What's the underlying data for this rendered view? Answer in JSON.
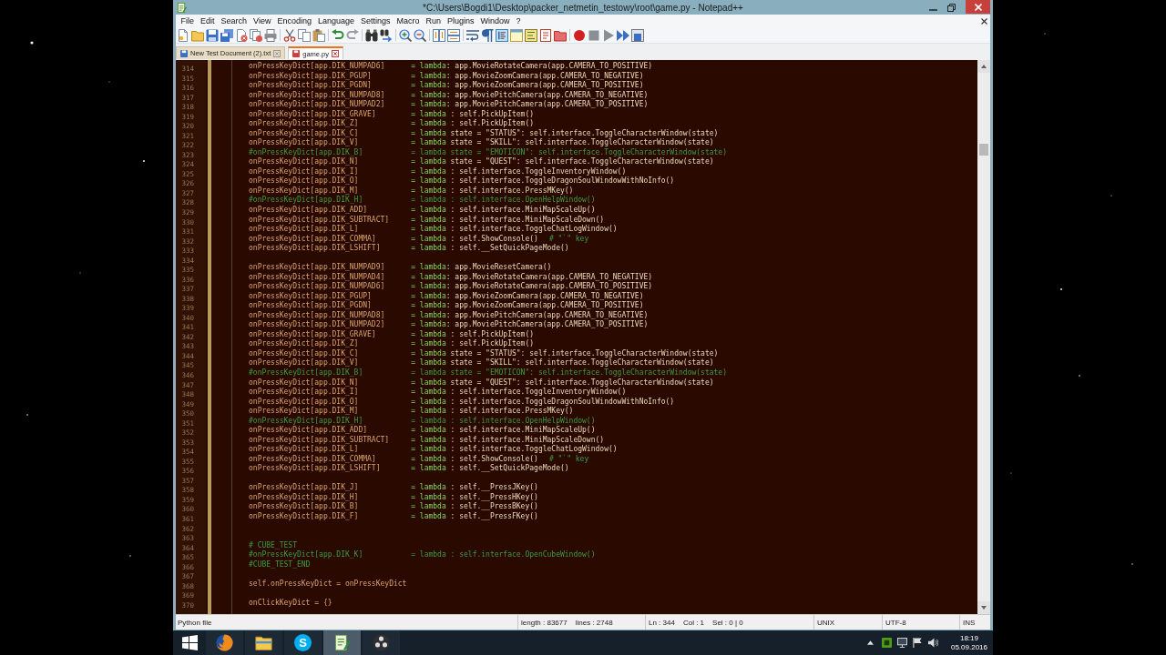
{
  "window": {
    "title": "*C:\\Users\\Bogdi1\\Desktop\\packer_netmetin_testowy\\root\\game.py - Notepad++"
  },
  "menu": [
    "File",
    "Edit",
    "Search",
    "View",
    "Encoding",
    "Language",
    "Settings",
    "Macro",
    "Run",
    "Plugins",
    "Window",
    "?"
  ],
  "toolbar": [
    [
      {
        "kind": "new",
        "on": false
      },
      {
        "kind": "open",
        "on": false
      },
      {
        "kind": "save",
        "on": false
      },
      {
        "kind": "save-all",
        "on": false
      },
      {
        "kind": "close",
        "on": false
      },
      {
        "kind": "close-all",
        "on": false
      },
      {
        "kind": "print",
        "on": false
      }
    ],
    [
      {
        "kind": "cut",
        "on": false
      },
      {
        "kind": "copy",
        "on": false
      },
      {
        "kind": "paste",
        "on": false
      }
    ],
    [
      {
        "kind": "undo",
        "on": false
      },
      {
        "kind": "redo",
        "on": false
      }
    ],
    [
      {
        "kind": "find",
        "on": false
      },
      {
        "kind": "replace",
        "on": false
      }
    ],
    [
      {
        "kind": "zoom-in",
        "on": false
      },
      {
        "kind": "zoom-out",
        "on": false
      }
    ],
    [
      {
        "kind": "sync-v",
        "on": false
      },
      {
        "kind": "sync-h",
        "on": false
      }
    ],
    [
      {
        "kind": "wrap",
        "on": false
      },
      {
        "kind": "all-chars",
        "on": false
      },
      {
        "kind": "indent-guide",
        "on": true
      },
      {
        "kind": "udl",
        "on": false
      },
      {
        "kind": "doc-map",
        "on": false
      },
      {
        "kind": "function-list",
        "on": false
      },
      {
        "kind": "workspace",
        "on": false
      }
    ],
    [
      {
        "kind": "record",
        "on": false
      },
      {
        "kind": "stop",
        "on": false
      },
      {
        "kind": "play",
        "on": false
      },
      {
        "kind": "play-multi",
        "on": false
      },
      {
        "kind": "save-macro",
        "on": false
      }
    ]
  ],
  "tabs": [
    {
      "label": "New Test Document (2).txt",
      "selected": false,
      "modified": false
    },
    {
      "label": "game.py",
      "selected": true,
      "modified": true
    }
  ],
  "editor": {
    "lines": [
      {
        "number": "314",
        "kind": "code",
        "target": "onPressKeyDict[app.DIK_NUMPAD6]",
        "op": "= lambda",
        "body": ": app.MovieRotateCamera(app.CAMERA_TO_POSITIVE)"
      },
      {
        "number": "315",
        "kind": "code",
        "target": "onPressKeyDict[app.DIK_PGUP]",
        "op": "= lambda",
        "body": ": app.MovieZoomCamera(app.CAMERA_TO_NEGATIVE)"
      },
      {
        "number": "316",
        "kind": "code",
        "target": "onPressKeyDict[app.DIK_PGDN]",
        "op": "= lambda",
        "body": ": app.MovieZoomCamera(app.CAMERA_TO_POSITIVE)"
      },
      {
        "number": "317",
        "kind": "code",
        "target": "onPressKeyDict[app.DIK_NUMPAD8]",
        "op": "= lambda",
        "body": ": app.MoviePitchCamera(app.CAMERA_TO_NEGATIVE)"
      },
      {
        "number": "318",
        "kind": "code",
        "target": "onPressKeyDict[app.DIK_NUMPAD2]",
        "op": "= lambda",
        "body": ": app.MoviePitchCamera(app.CAMERA_TO_POSITIVE)"
      },
      {
        "number": "319",
        "kind": "code",
        "target": "onPressKeyDict[app.DIK_GRAVE]",
        "op": "= lambda",
        "body": " : self.PickUpItem()"
      },
      {
        "number": "320",
        "kind": "code",
        "target": "onPressKeyDict[app.DIK_Z]",
        "op": "= lambda",
        "body": " : self.PickUpItem()"
      },
      {
        "number": "321",
        "kind": "code",
        "target": "onPressKeyDict[app.DIK_C]",
        "op": "= lambda",
        "body": " state = \"STATUS\": self.interface.ToggleCharacterWindow(state)"
      },
      {
        "number": "322",
        "kind": "code",
        "target": "onPressKeyDict[app.DIK_V]",
        "op": "= lambda",
        "body": " state = \"SKILL\": self.interface.ToggleCharacterWindow(state)"
      },
      {
        "number": "323",
        "kind": "comment",
        "target": "#onPressKeyDict[app.DIK_B]",
        "op": "= lambda",
        "body": " state = \"EMOTICON\": self.interface.ToggleCharacterWindow(state)"
      },
      {
        "number": "324",
        "kind": "code",
        "target": "onPressKeyDict[app.DIK_N]",
        "op": "= lambda",
        "body": " state = \"QUEST\": self.interface.ToggleCharacterWindow(state)"
      },
      {
        "number": "325",
        "kind": "code",
        "target": "onPressKeyDict[app.DIK_I]",
        "op": "= lambda",
        "body": " : self.interface.ToggleInventoryWindow()"
      },
      {
        "number": "326",
        "kind": "code",
        "target": "onPressKeyDict[app.DIK_O]",
        "op": "= lambda",
        "body": " : self.interface.ToggleDragonSoulWindowWithNoInfo()"
      },
      {
        "number": "327",
        "kind": "code",
        "target": "onPressKeyDict[app.DIK_M]",
        "op": "= lambda",
        "body": " : self.interface.PressMKey()"
      },
      {
        "number": "328",
        "kind": "comment",
        "target": "#onPressKeyDict[app.DIK_H]",
        "op": "= lambda",
        "body": " : self.interface.OpenHelpWindow()"
      },
      {
        "number": "329",
        "kind": "code",
        "target": "onPressKeyDict[app.DIK_ADD]",
        "op": "= lambda",
        "body": " : self.interface.MiniMapScaleUp()"
      },
      {
        "number": "330",
        "kind": "code",
        "target": "onPressKeyDict[app.DIK_SUBTRACT]",
        "op": "= lambda",
        "body": " : self.interface.MiniMapScaleDown()"
      },
      {
        "number": "331",
        "kind": "code",
        "target": "onPressKeyDict[app.DIK_L]",
        "op": "= lambda",
        "body": " : self.interface.ToggleChatLogWindow()"
      },
      {
        "number": "332",
        "kind": "code",
        "target": "onPressKeyDict[app.DIK_COMMA]",
        "op": "= lambda",
        "body": " : self.ShowConsole()",
        "trailing": "# \"`\" key"
      },
      {
        "number": "333",
        "kind": "code",
        "target": "onPressKeyDict[app.DIK_LSHIFT]",
        "op": "= lambda",
        "body": " : self.__SetQuickPageMode()"
      },
      {
        "number": "334",
        "kind": "blank"
      },
      {
        "number": "335",
        "kind": "code",
        "target": "onPressKeyDict[app.DIK_NUMPAD9]",
        "op": "= lambda",
        "body": ": app.MovieResetCamera()"
      },
      {
        "number": "336",
        "kind": "code",
        "target": "onPressKeyDict[app.DIK_NUMPAD4]",
        "op": "= lambda",
        "body": ": app.MovieRotateCamera(app.CAMERA_TO_NEGATIVE)"
      },
      {
        "number": "337",
        "kind": "code",
        "target": "onPressKeyDict[app.DIK_NUMPAD6]",
        "op": "= lambda",
        "body": ": app.MovieRotateCamera(app.CAMERA_TO_POSITIVE)"
      },
      {
        "number": "338",
        "kind": "code",
        "target": "onPressKeyDict[app.DIK_PGUP]",
        "op": "= lambda",
        "body": ": app.MovieZoomCamera(app.CAMERA_TO_NEGATIVE)"
      },
      {
        "number": "339",
        "kind": "code",
        "target": "onPressKeyDict[app.DIK_PGDN]",
        "op": "= lambda",
        "body": ": app.MovieZoomCamera(app.CAMERA_TO_POSITIVE)"
      },
      {
        "number": "340",
        "kind": "code",
        "target": "onPressKeyDict[app.DIK_NUMPAD8]",
        "op": "= lambda",
        "body": ": app.MoviePitchCamera(app.CAMERA_TO_NEGATIVE)"
      },
      {
        "number": "341",
        "kind": "code",
        "target": "onPressKeyDict[app.DIK_NUMPAD2]",
        "op": "= lambda",
        "body": ": app.MoviePitchCamera(app.CAMERA_TO_POSITIVE)"
      },
      {
        "number": "342",
        "kind": "code",
        "target": "onPressKeyDict[app.DIK_GRAVE]",
        "op": "= lambda",
        "body": " : self.PickUpItem()"
      },
      {
        "number": "343",
        "kind": "code",
        "target": "onPressKeyDict[app.DIK_Z]",
        "op": "= lambda",
        "body": " : self.PickUpItem()"
      },
      {
        "number": "344",
        "kind": "code",
        "target": "onPressKeyDict[app.DIK_C]",
        "op": "= lambda",
        "body": " state = \"STATUS\": self.interface.ToggleCharacterWindow(state)"
      },
      {
        "number": "345",
        "kind": "code",
        "target": "onPressKeyDict[app.DIK_V]",
        "op": "= lambda",
        "body": " state = \"SKILL\": self.interface.ToggleCharacterWindow(state)"
      },
      {
        "number": "346",
        "kind": "comment",
        "target": "#onPressKeyDict[app.DIK_B]",
        "op": "= lambda",
        "body": " state = \"EMOTICON\": self.interface.ToggleCharacterWindow(state)"
      },
      {
        "number": "347",
        "kind": "code",
        "target": "onPressKeyDict[app.DIK_N]",
        "op": "= lambda",
        "body": " state = \"QUEST\": self.interface.ToggleCharacterWindow(state)"
      },
      {
        "number": "348",
        "kind": "code",
        "target": "onPressKeyDict[app.DIK_I]",
        "op": "= lambda",
        "body": " : self.interface.ToggleInventoryWindow()"
      },
      {
        "number": "349",
        "kind": "code",
        "target": "onPressKeyDict[app.DIK_O]",
        "op": "= lambda",
        "body": " : self.interface.ToggleDragonSoulWindowWithNoInfo()"
      },
      {
        "number": "350",
        "kind": "code",
        "target": "onPressKeyDict[app.DIK_M]",
        "op": "= lambda",
        "body": " : self.interface.PressMKey()"
      },
      {
        "number": "351",
        "kind": "comment",
        "target": "#onPressKeyDict[app.DIK_H]",
        "op": "= lambda",
        "body": " : self.interface.OpenHelpWindow()"
      },
      {
        "number": "352",
        "kind": "code",
        "target": "onPressKeyDict[app.DIK_ADD]",
        "op": "= lambda",
        "body": " : self.interface.MiniMapScaleUp()"
      },
      {
        "number": "353",
        "kind": "code",
        "target": "onPressKeyDict[app.DIK_SUBTRACT]",
        "op": "= lambda",
        "body": " : self.interface.MiniMapScaleDown()"
      },
      {
        "number": "354",
        "kind": "code",
        "target": "onPressKeyDict[app.DIK_L]",
        "op": "= lambda",
        "body": " : self.interface.ToggleChatLogWindow()"
      },
      {
        "number": "355",
        "kind": "code",
        "target": "onPressKeyDict[app.DIK_COMMA]",
        "op": "= lambda",
        "body": " : self.ShowConsole()",
        "trailing": "# \"`\" key"
      },
      {
        "number": "356",
        "kind": "code",
        "target": "onPressKeyDict[app.DIK_LSHIFT]",
        "op": "= lambda",
        "body": " : self.__SetQuickPageMode()"
      },
      {
        "number": "357",
        "kind": "blank"
      },
      {
        "number": "358",
        "kind": "code",
        "target": "onPressKeyDict[app.DIK_J]",
        "op": "= lambda",
        "body": " : self.__PressJKey()"
      },
      {
        "number": "359",
        "kind": "code",
        "target": "onPressKeyDict[app.DIK_H]",
        "op": "= lambda",
        "body": " : self.__PressHKey()"
      },
      {
        "number": "360",
        "kind": "code",
        "target": "onPressKeyDict[app.DIK_B]",
        "op": "= lambda",
        "body": " : self.__PressBKey()"
      },
      {
        "number": "361",
        "kind": "code",
        "target": "onPressKeyDict[app.DIK_F]",
        "op": "= lambda",
        "body": " : self.__PressFKey()"
      },
      {
        "number": "362",
        "kind": "blank"
      },
      {
        "number": "363",
        "kind": "blank"
      },
      {
        "number": "364",
        "kind": "comment",
        "target": "# CUBE_TEST"
      },
      {
        "number": "365",
        "kind": "comment",
        "target": "#onPressKeyDict[app.DIK_K]",
        "op": "= lambda",
        "body": " : self.interface.OpenCubeWindow()"
      },
      {
        "number": "366",
        "kind": "comment",
        "target": "#CUBE_TEST_END"
      },
      {
        "number": "367",
        "kind": "blank"
      },
      {
        "number": "368",
        "kind": "plain",
        "text": "self.onPressKeyDict = onPressKeyDict"
      },
      {
        "number": "369",
        "kind": "blank"
      },
      {
        "number": "370",
        "kind": "plain",
        "text": "onClickKeyDict = {}"
      }
    ]
  },
  "status_bar": [
    [
      "Python file"
    ],
    [
      "length : 83677",
      "lines : 2748"
    ],
    [
      "Ln : 344",
      "Col : 1",
      "Sel : 0 | 0"
    ],
    [
      "UNIX"
    ],
    [
      "UTF-8"
    ],
    [
      "INS"
    ]
  ],
  "taskbar": {
    "apps": [
      {
        "kind": "browser",
        "selected": false
      },
      {
        "kind": "folder",
        "selected": false
      },
      {
        "kind": "chat",
        "glyph": "S",
        "selected": false
      },
      {
        "kind": "notepad",
        "selected": true
      },
      {
        "kind": "recorder",
        "selected": false
      }
    ],
    "clock": {
      "time": "18:19",
      "date": "05.09.2016"
    }
  }
}
